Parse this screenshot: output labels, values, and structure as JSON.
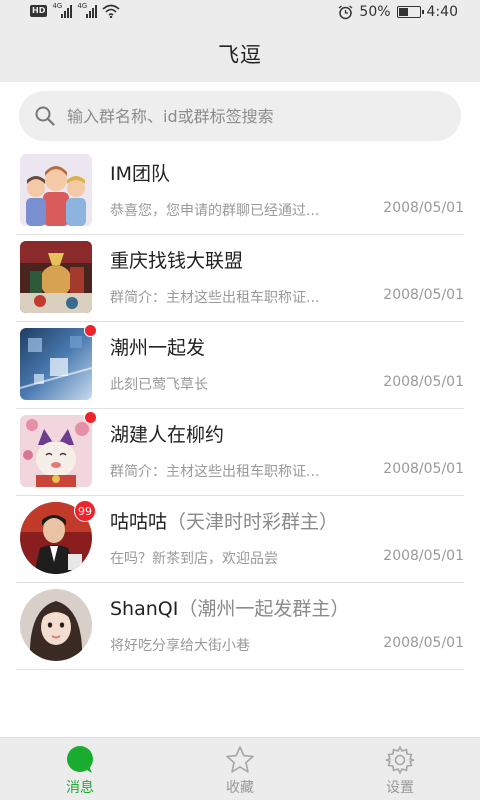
{
  "status_bar": {
    "hd": "HD",
    "network_1": "4G",
    "network_2": "4G",
    "battery": "50%",
    "time": "4:40",
    "battery_level": 0.5
  },
  "header": {
    "title": "飞逗"
  },
  "search": {
    "placeholder": "输入群名称、id或群标签搜索"
  },
  "groups": [
    {
      "name": "IM团队",
      "owner": "",
      "preview": "恭喜您，您申请的群聊已经通过...",
      "date": "2008/05/01",
      "unread_dot": false,
      "badge": ""
    },
    {
      "name": "重庆找钱大联盟",
      "owner": "",
      "preview": "群简介：主材这些出租车职称证...",
      "date": "2008/05/01",
      "unread_dot": false,
      "badge": ""
    },
    {
      "name": "潮州一起发",
      "owner": "",
      "preview": "此刻已莺飞草长",
      "date": "2008/05/01",
      "unread_dot": true,
      "badge": ""
    },
    {
      "name": "湖建人在柳约",
      "owner": "",
      "preview": "群简介：主材这些出租车职称证...",
      "date": "2008/05/01",
      "unread_dot": true,
      "badge": ""
    },
    {
      "name": "咕咕咕",
      "owner": "（天津时时彩群主）",
      "preview": "在吗？新茶到店，欢迎品尝",
      "date": "2008/05/01",
      "unread_dot": false,
      "badge": "99"
    },
    {
      "name": "ShanQI",
      "owner": "（潮州一起发群主）",
      "preview": "将好吃分享给大街小巷",
      "date": "2008/05/01",
      "unread_dot": false,
      "badge": ""
    }
  ],
  "bottom_nav": {
    "tabs": [
      {
        "label": "消息",
        "active": true,
        "icon": "chat-bubble-icon"
      },
      {
        "label": "收藏",
        "active": false,
        "icon": "star-icon"
      },
      {
        "label": "设置",
        "active": false,
        "icon": "gear-icon"
      }
    ]
  },
  "colors": {
    "accent": "#1aac2e",
    "badge": "#f0222c",
    "bar_bg": "#ececec"
  }
}
